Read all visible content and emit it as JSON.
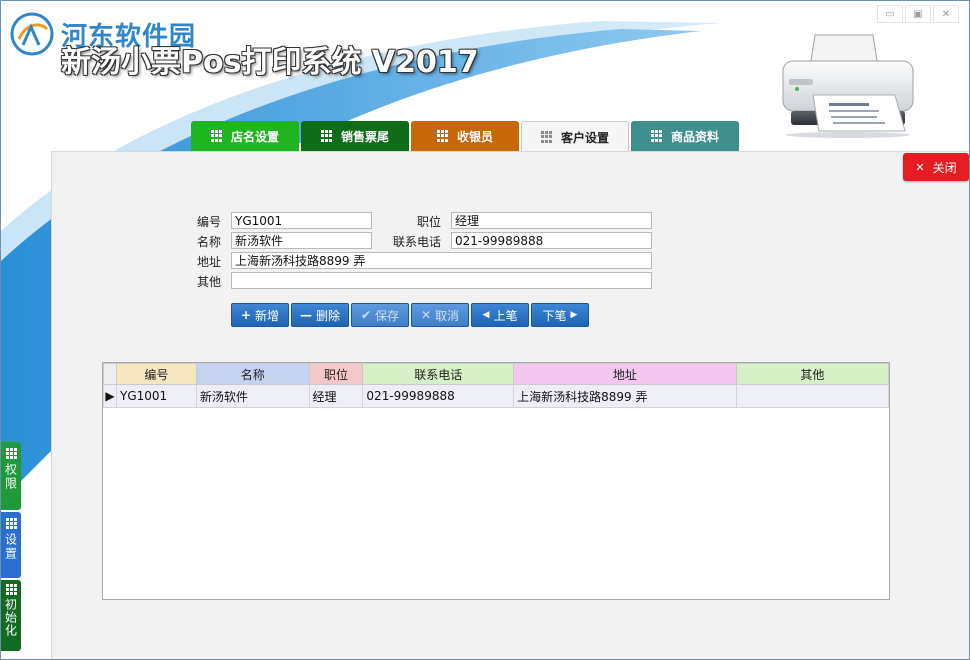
{
  "watermark": {
    "text": "河东软件园"
  },
  "app": {
    "title": "新汤小票Pos打印系统 V2017"
  },
  "window_controls": [
    {
      "name": "minimize",
      "glyph": "▭"
    },
    {
      "name": "maximize",
      "glyph": "▣"
    },
    {
      "name": "close",
      "glyph": "✕"
    }
  ],
  "tabs": [
    {
      "label": "店名设置",
      "color": "#1fb51f",
      "active": false
    },
    {
      "label": "销售票尾",
      "color": "#0f6d17",
      "active": false
    },
    {
      "label": "收银员",
      "color": "#c8660a",
      "active": false
    },
    {
      "label": "客户设置",
      "color": "#f5f5f5",
      "active": true
    },
    {
      "label": "商品资料",
      "color": "#3f8f8f",
      "active": false
    }
  ],
  "close_button": {
    "label": "关闭",
    "icon": "close-icon",
    "color": "#e51c23"
  },
  "form": {
    "code_label": "编号",
    "code_value": "YG1001",
    "position_label": "职位",
    "position_value": "经理",
    "name_label": "名称",
    "name_value": "新汤软件",
    "phone_label": "联系电话",
    "phone_value": "021-99989888",
    "address_label": "地址",
    "address_value": "上海新汤科技路8899 弄",
    "other_label": "其他",
    "other_value": ""
  },
  "buttons": {
    "add": {
      "label": "新增",
      "glyph": "+"
    },
    "delete": {
      "label": "删除",
      "glyph": "—"
    },
    "save": {
      "label": "保存",
      "glyph": "✔"
    },
    "cancel": {
      "label": "取消",
      "glyph": "✕"
    },
    "prev": {
      "label": "上笔",
      "glyph": "◀"
    },
    "next": {
      "label": "下笔",
      "glyph": "▶"
    }
  },
  "table": {
    "columns": [
      {
        "label": "编号",
        "color": "#f7e7bf"
      },
      {
        "label": "名称",
        "color": "#c5d3f1"
      },
      {
        "label": "职位",
        "color": "#f4c8c8"
      },
      {
        "label": "联系电话",
        "color": "#d6f0c8"
      },
      {
        "label": "地址",
        "color": "#f2c6ee"
      },
      {
        "label": "其他",
        "color": "#d6f0c8"
      }
    ],
    "rows": [
      [
        "YG1001",
        "新汤软件",
        "经理",
        "021-99989888",
        "上海新汤科技路8899 弄",
        ""
      ]
    ]
  },
  "side_tabs": [
    {
      "label": "权限",
      "color": "#1f9a3a"
    },
    {
      "label": "设置",
      "color": "#2a6fd0"
    },
    {
      "label": "初始化",
      "color": "#136b22"
    }
  ]
}
